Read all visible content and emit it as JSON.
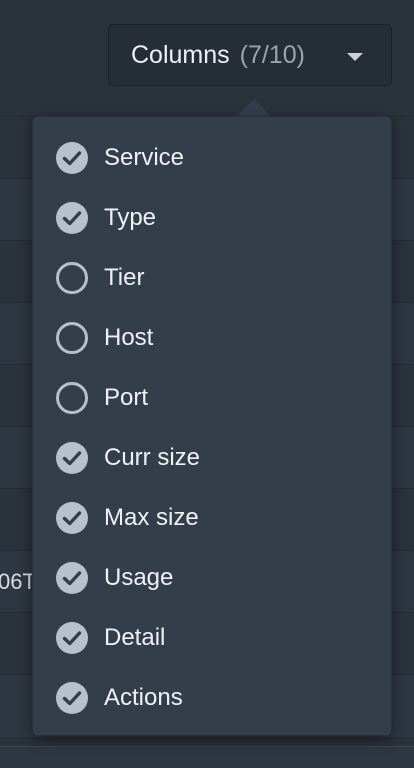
{
  "toolbar": {
    "columns_label": "Columns",
    "columns_count": "(7/10)"
  },
  "background": {
    "partial_cell_text": "06T"
  },
  "menu": {
    "items": [
      {
        "label": "Service",
        "checked": true
      },
      {
        "label": "Type",
        "checked": true
      },
      {
        "label": "Tier",
        "checked": false
      },
      {
        "label": "Host",
        "checked": false
      },
      {
        "label": "Port",
        "checked": false
      },
      {
        "label": "Curr size",
        "checked": true
      },
      {
        "label": "Max size",
        "checked": true
      },
      {
        "label": "Usage",
        "checked": true
      },
      {
        "label": "Detail",
        "checked": true
      },
      {
        "label": "Actions",
        "checked": true
      }
    ]
  },
  "colors": {
    "check_fill": "#b7c1cc",
    "check_mark": "#333e4a",
    "radio_stroke": "#b7c1cc"
  },
  "icons": {
    "checked": "check-circle-icon",
    "unchecked": "empty-circle-icon",
    "dropdown": "caret-down-icon"
  }
}
